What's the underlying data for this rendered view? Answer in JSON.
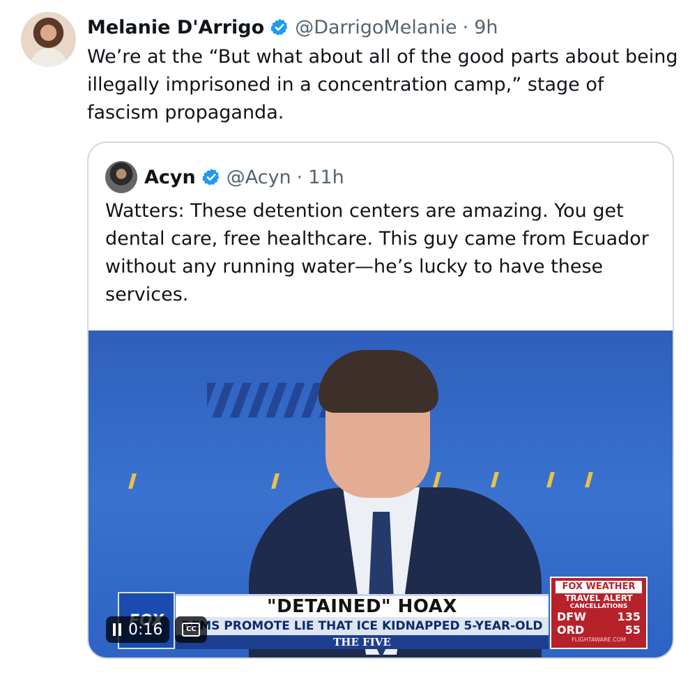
{
  "tweet": {
    "author_name": "Melanie D'Arrigo",
    "handle": "@DarrigoMelanie",
    "separator": "·",
    "time": "9h",
    "text": "We’re at the “But what about all of the good parts about being illegally imprisoned in a concentration camp,” stage of fascism propaganda."
  },
  "quoted": {
    "author_name": "Acyn",
    "handle": "@Acyn",
    "separator": "·",
    "time": "11h",
    "text": "Watters: These detention centers are amazing. You get dental care, free healthcare. This guy came from Ecuador without any running water—he’s lucky to have these services."
  },
  "video": {
    "network_logo": "FOX",
    "chyron_headline": "\"DETAINED\" HOAX",
    "chyron_subline": "DEMS PROMOTE LIE THAT ICE KIDNAPPED 5-YEAR-OLD",
    "show_name": "THE FIVE",
    "weather": {
      "logo": "FOX WEATHER",
      "title": "TRAVEL ALERT",
      "subtitle": "CANCELLATIONS",
      "rows": [
        {
          "code": "DFW",
          "value": "135"
        },
        {
          "code": "ORD",
          "value": "55"
        }
      ],
      "source": "FLIGHTAWARE.COM"
    },
    "timestamp": "0:16",
    "cc_label": "CC"
  },
  "colors": {
    "verified": "#1d9bf0",
    "muted": "#536471",
    "border": "#cfd9de"
  }
}
